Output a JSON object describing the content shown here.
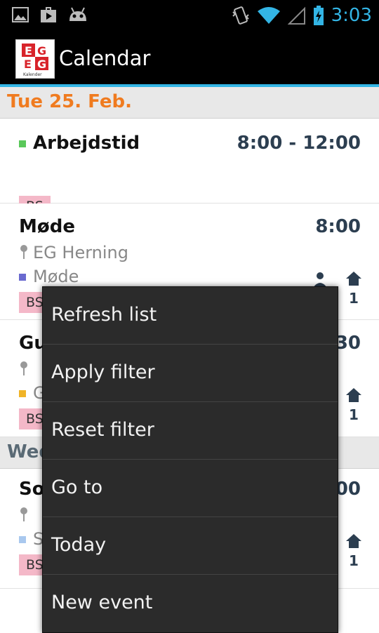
{
  "status_bar": {
    "time": "3:03",
    "left_icons": [
      "image-icon",
      "play-store-icon",
      "android-debug-icon"
    ],
    "right_icons": [
      "vibrate-icon",
      "wifi-icon",
      "signal-icon",
      "battery-charging-icon"
    ]
  },
  "action_bar": {
    "title": "Calendar",
    "logo_text_top": "EG",
    "logo_caption": "Kalender"
  },
  "days": [
    {
      "label": "Tue 25. Feb."
    },
    {
      "label": "Wed"
    }
  ],
  "events": [
    {
      "title": "Arbejdstid",
      "time": "8:00 - 12:00",
      "category_color": "#5ac85a",
      "tag": "BS"
    },
    {
      "title": "Møde",
      "time": "8:00",
      "location": "EG Herning",
      "category": "Møde",
      "category_color": "#6a6acf",
      "tag": "BS",
      "count": "1"
    },
    {
      "title": "Gu",
      "time": "30",
      "location": "",
      "category": "G",
      "category_color": "#f0b428",
      "tag": "BS",
      "count": "1"
    },
    {
      "title": "So",
      "time": "00",
      "location": "",
      "category": "S",
      "category_color": "#a9c8ee",
      "tag": "BS",
      "count": "1"
    }
  ],
  "menu": {
    "items": [
      {
        "label": "Refresh list"
      },
      {
        "label": "Apply filter"
      },
      {
        "label": "Reset filter"
      },
      {
        "label": "Go to"
      },
      {
        "label": "Today"
      },
      {
        "label": "New event"
      }
    ]
  }
}
